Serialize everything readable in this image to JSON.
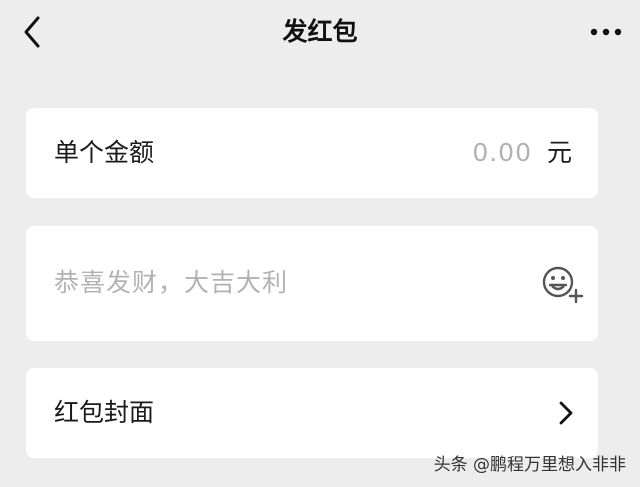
{
  "header": {
    "title": "发红包",
    "back_icon": "chevron-left-icon",
    "more_icon": "more-dots-icon"
  },
  "amount": {
    "label": "单个金额",
    "value": "0.00",
    "unit": "元"
  },
  "greeting": {
    "placeholder": "恭喜发财，大吉大利",
    "emoji_icon": "emoji-add-icon"
  },
  "cover": {
    "label": "红包封面",
    "chevron_icon": "chevron-right-icon"
  },
  "watermark": {
    "text": "头条 @鹏程万里想入非非"
  },
  "colors": {
    "background": "#ededed",
    "card": "#ffffff",
    "text": "#1a1a1a",
    "placeholder": "#b2b2b2"
  }
}
